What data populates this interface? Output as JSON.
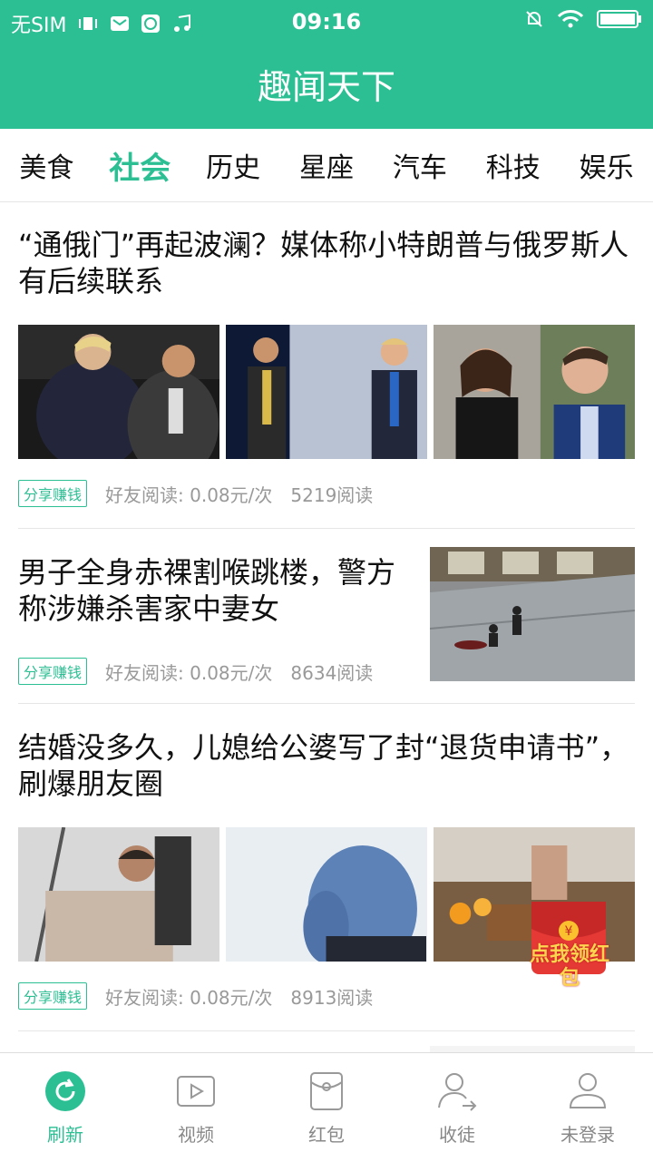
{
  "status": {
    "carrier": "无SIM",
    "time": "09:16"
  },
  "app": {
    "title": "趣闻天下"
  },
  "tabs": [
    "美食",
    "社会",
    "历史",
    "星座",
    "汽车",
    "科技",
    "娱乐"
  ],
  "active_tab": "社会",
  "articles": [
    {
      "title": "“通俄门”再起波澜？媒体称小特朗普与俄罗斯人有后续联系",
      "badge": "分享赚钱",
      "reward": "好友阅读: 0.08元/次",
      "reads": "5219阅读"
    },
    {
      "title": "男子全身赤裸割喉跳楼，警方称涉嫌杀害家中妻女",
      "badge": "分享赚钱",
      "reward": "好友阅读: 0.08元/次",
      "reads": "8634阅读"
    },
    {
      "title": "结婚没多久，儿媳给公婆写了封“退货申请书”，刷爆朋友圈",
      "badge": "分享赚钱",
      "reward": "好友阅读: 0.08元/次",
      "reads": "8913阅读"
    }
  ],
  "promo": {
    "label": "点我领红包",
    "color": "#e53935"
  },
  "bottom_nav": [
    {
      "label": "刷新",
      "icon": "refresh-icon"
    },
    {
      "label": "视频",
      "icon": "video-icon"
    },
    {
      "label": "红包",
      "icon": "red-packet-icon"
    },
    {
      "label": "收徒",
      "icon": "add-disciple-icon"
    },
    {
      "label": "未登录",
      "icon": "profile-icon"
    }
  ],
  "colors": {
    "accent": "#2cbf93"
  }
}
